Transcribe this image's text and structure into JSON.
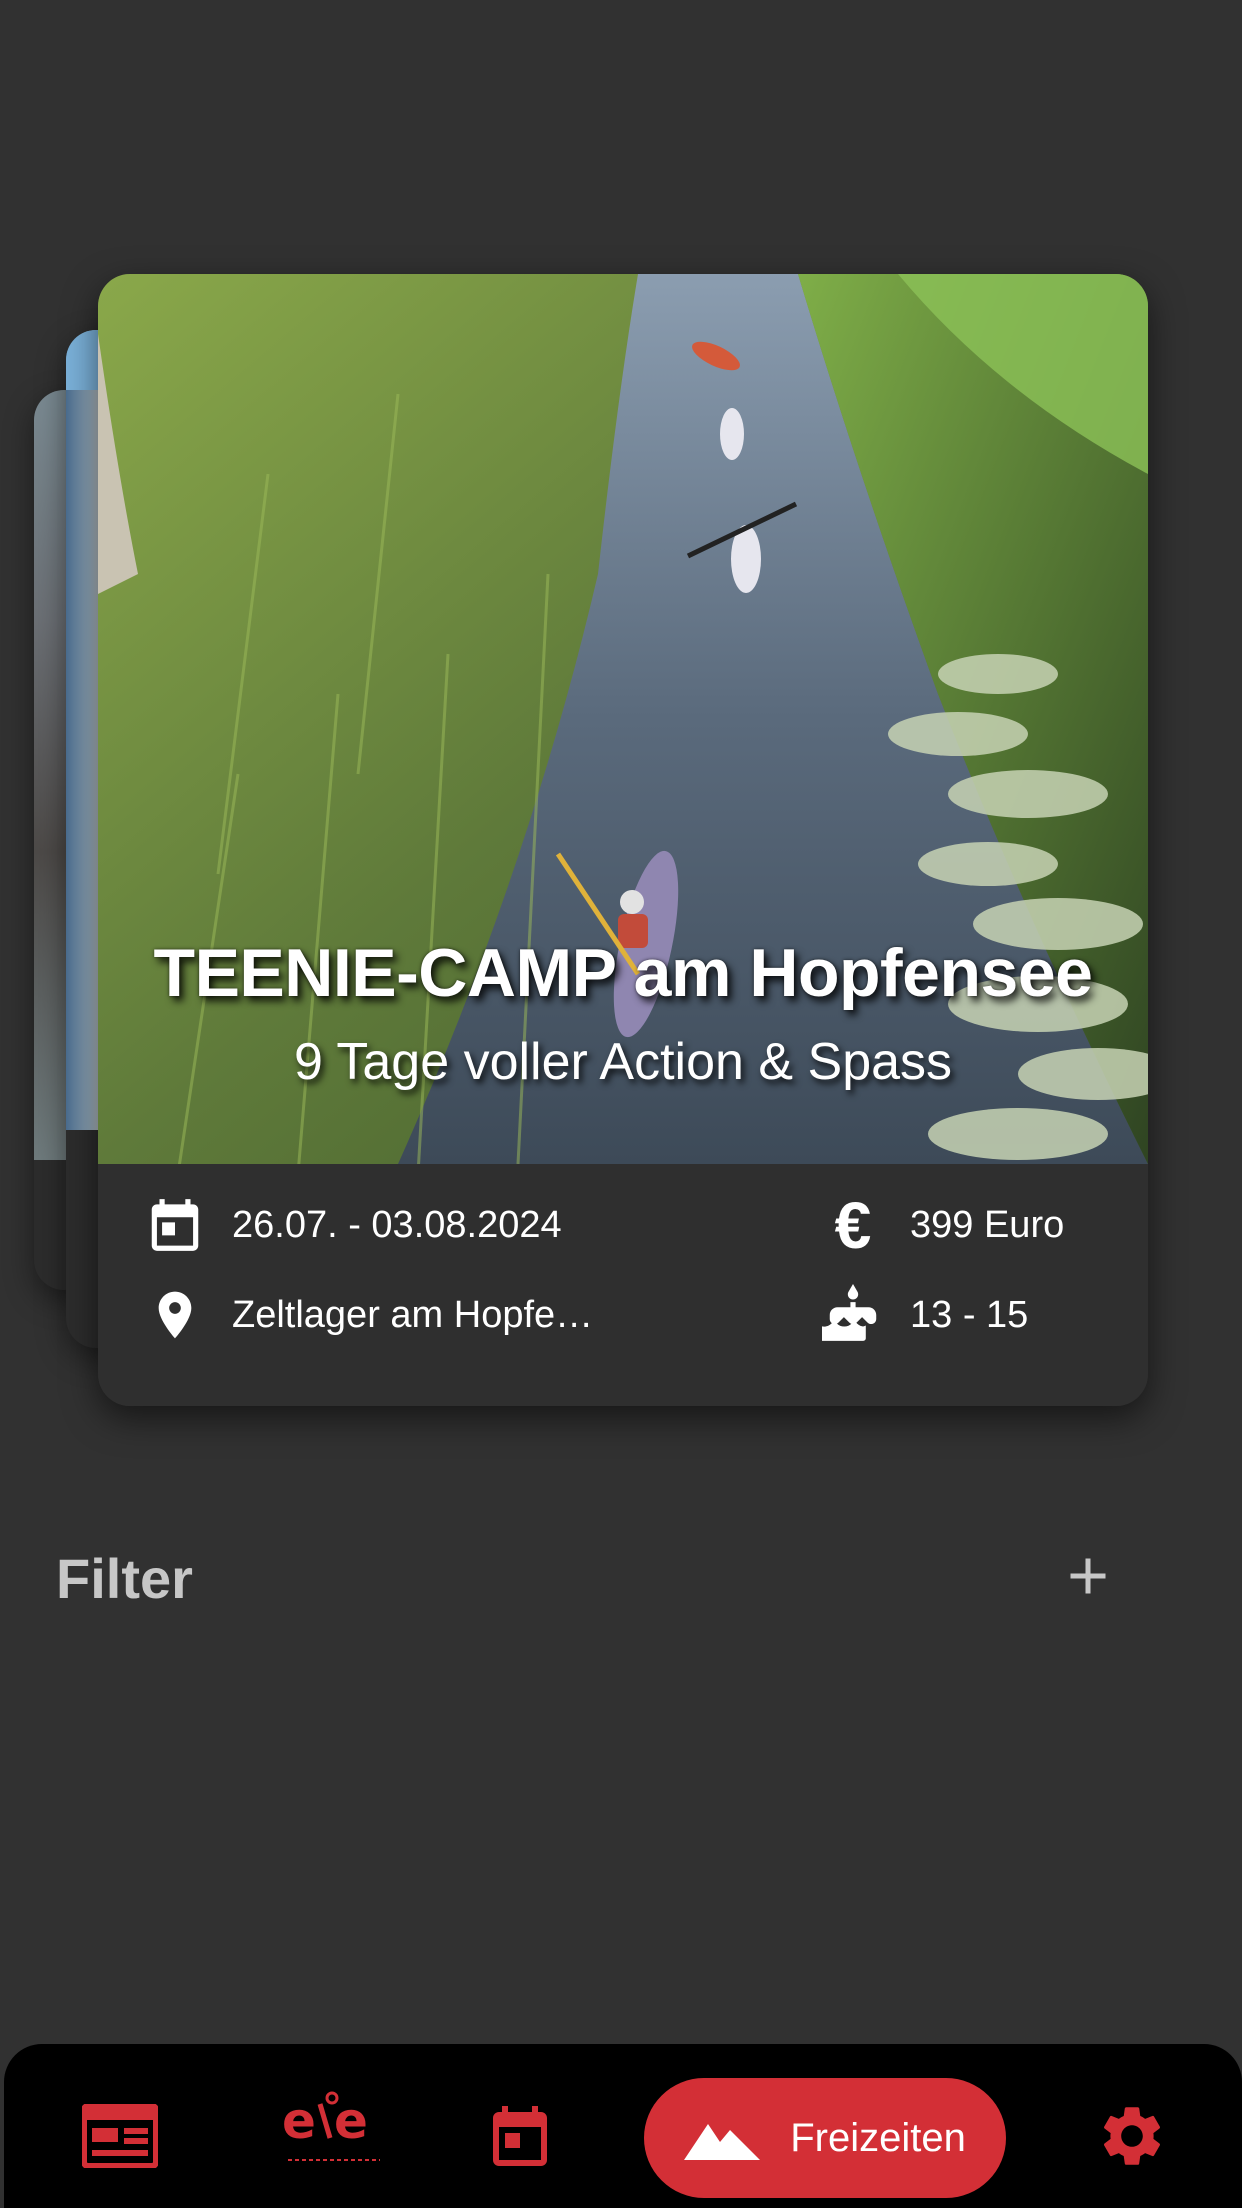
{
  "card": {
    "title": "TEENIE-CAMP am Hopfensee",
    "subtitle": "9 Tage voller Action & Spass",
    "date": "26.07. - 03.08.2024",
    "location": "Zeltlager am Hopfe…",
    "price": "399 Euro",
    "age": "13 - 15"
  },
  "filter": {
    "title": "Filter"
  },
  "nav": {
    "items": [
      {
        "icon": "newspaper-icon"
      },
      {
        "icon": "ele-logo"
      },
      {
        "icon": "calendar-icon"
      },
      {
        "icon": "mountain-icon",
        "label": "Freizeiten",
        "active": true
      },
      {
        "icon": "gear-icon"
      }
    ],
    "accent": "#d32f36"
  },
  "colors": {
    "background": "#313131",
    "accent": "#d32f36"
  }
}
